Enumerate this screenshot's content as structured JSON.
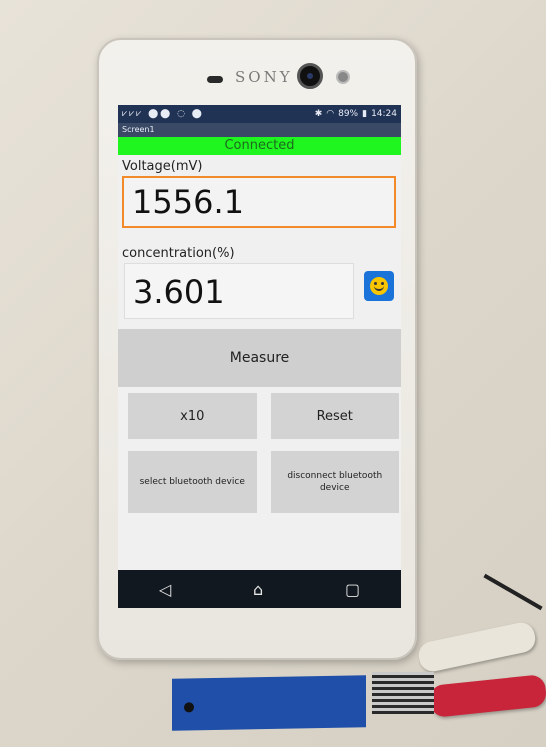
{
  "phone": {
    "brand": "SONY"
  },
  "status_bar": {
    "left_icons": "⩗⩗⩗ ⬤⬤ ◌ ⬤",
    "battery": "89%",
    "time": "14:24"
  },
  "app": {
    "screen_title": "Screen1",
    "connection_status": "Connected",
    "voltage_label": "Voltage(mV)",
    "voltage_value": "1556.1",
    "concentration_label": "concentration(%)",
    "concentration_value": "3.601",
    "measure_button": "Measure",
    "x10_button": "x10",
    "reset_button": "Reset",
    "select_bt_button": "select bluetooth device",
    "disconnect_bt_button": "disconnect bluetooth device"
  },
  "nav": {
    "back_glyph": "◁",
    "home_glyph": "⌂",
    "recents_glyph": "▢"
  },
  "colors": {
    "connected": "#1ff51f",
    "statusbar": "#213355",
    "voltage_border": "#f28a2a",
    "smile_button": "#1a73d9"
  }
}
